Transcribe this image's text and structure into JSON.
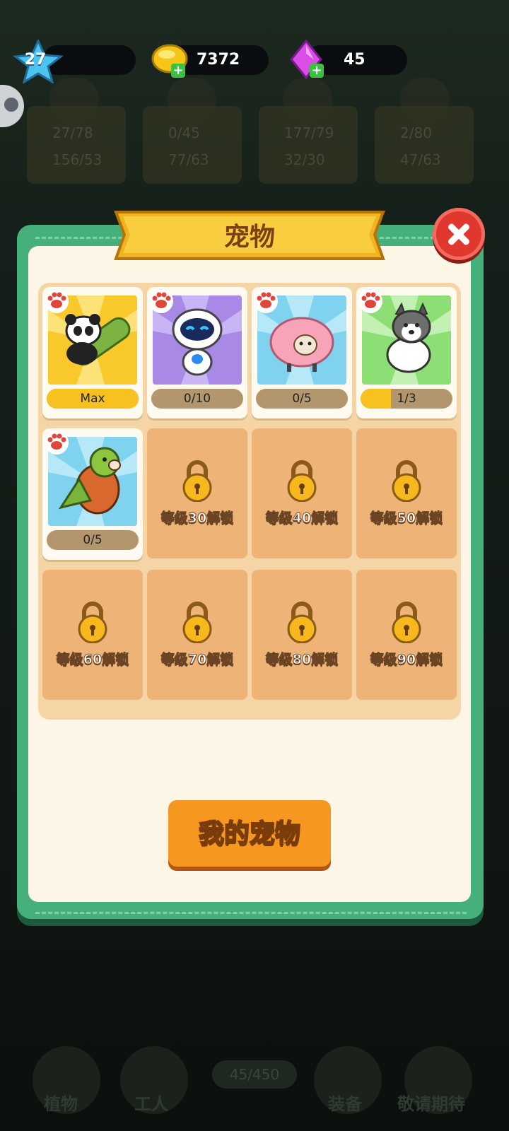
{
  "hud": {
    "level": "27",
    "coins": "7372",
    "gems": "45"
  },
  "dialog": {
    "title": "宠物",
    "my_pets_button": "我的宠物"
  },
  "pets": [
    {
      "name": "panda",
      "progress_label": "Max",
      "progress": 1.0
    },
    {
      "name": "robot",
      "progress_label": "0/10",
      "progress": 0.0
    },
    {
      "name": "sheep",
      "progress_label": "0/5",
      "progress": 0.0
    },
    {
      "name": "husky",
      "progress_label": "1/3",
      "progress": 0.33
    },
    {
      "name": "parrot",
      "progress_label": "0/5",
      "progress": 0.0
    }
  ],
  "locked_slots": [
    "等级30解锁",
    "等级40解锁",
    "等级50解锁",
    "等级60解锁",
    "等级70解锁",
    "等级80解锁",
    "等级90解锁"
  ],
  "background": {
    "cards": [
      {
        "stat1": "27/78",
        "stat2": "156/53"
      },
      {
        "stat1": "0/45",
        "stat2": "77/63"
      },
      {
        "stat1": "177/79",
        "stat2": "32/30"
      },
      {
        "stat1": "2/80",
        "stat2": "47/63"
      }
    ],
    "nav": [
      "植物",
      "工人",
      "装备",
      "敬请期待"
    ],
    "progress": "45/450"
  },
  "colors": {
    "dialog_frame": "#45b07a",
    "panel": "#fdf5e6",
    "locked_slot": "#eeb377",
    "button": "#f69720",
    "close": "#e0372f"
  }
}
